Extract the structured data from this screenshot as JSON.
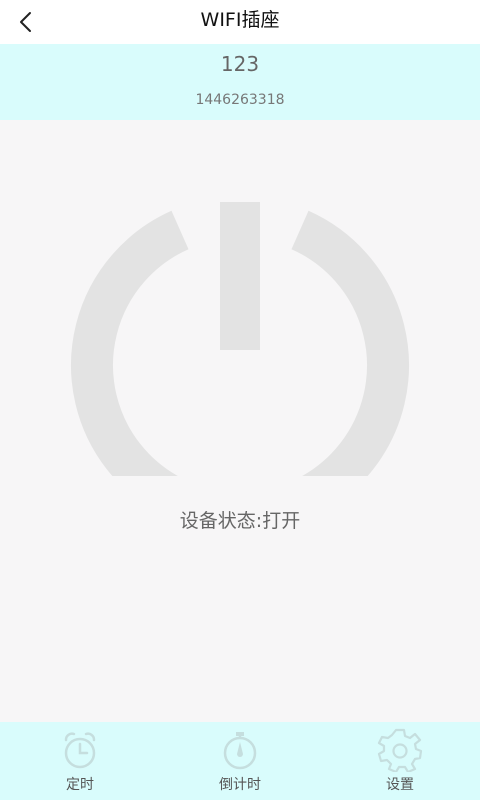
{
  "header": {
    "title": "WIFI插座",
    "back_icon": "chevron-left-icon"
  },
  "device": {
    "name": "123",
    "id": "1446263318"
  },
  "power": {
    "icon": "power-icon",
    "status_text": "设备状态:打开"
  },
  "tabs": [
    {
      "label": "定时",
      "icon": "alarm-clock-icon"
    },
    {
      "label": "倒计时",
      "icon": "stopwatch-icon"
    },
    {
      "label": "设置",
      "icon": "gear-icon"
    }
  ],
  "colors": {
    "background": "#f7f6f7",
    "accent_bar": "#d9fcfc",
    "power_icon": "#e3e3e3",
    "tab_icon": "#c5dede",
    "text_muted": "#666666"
  }
}
